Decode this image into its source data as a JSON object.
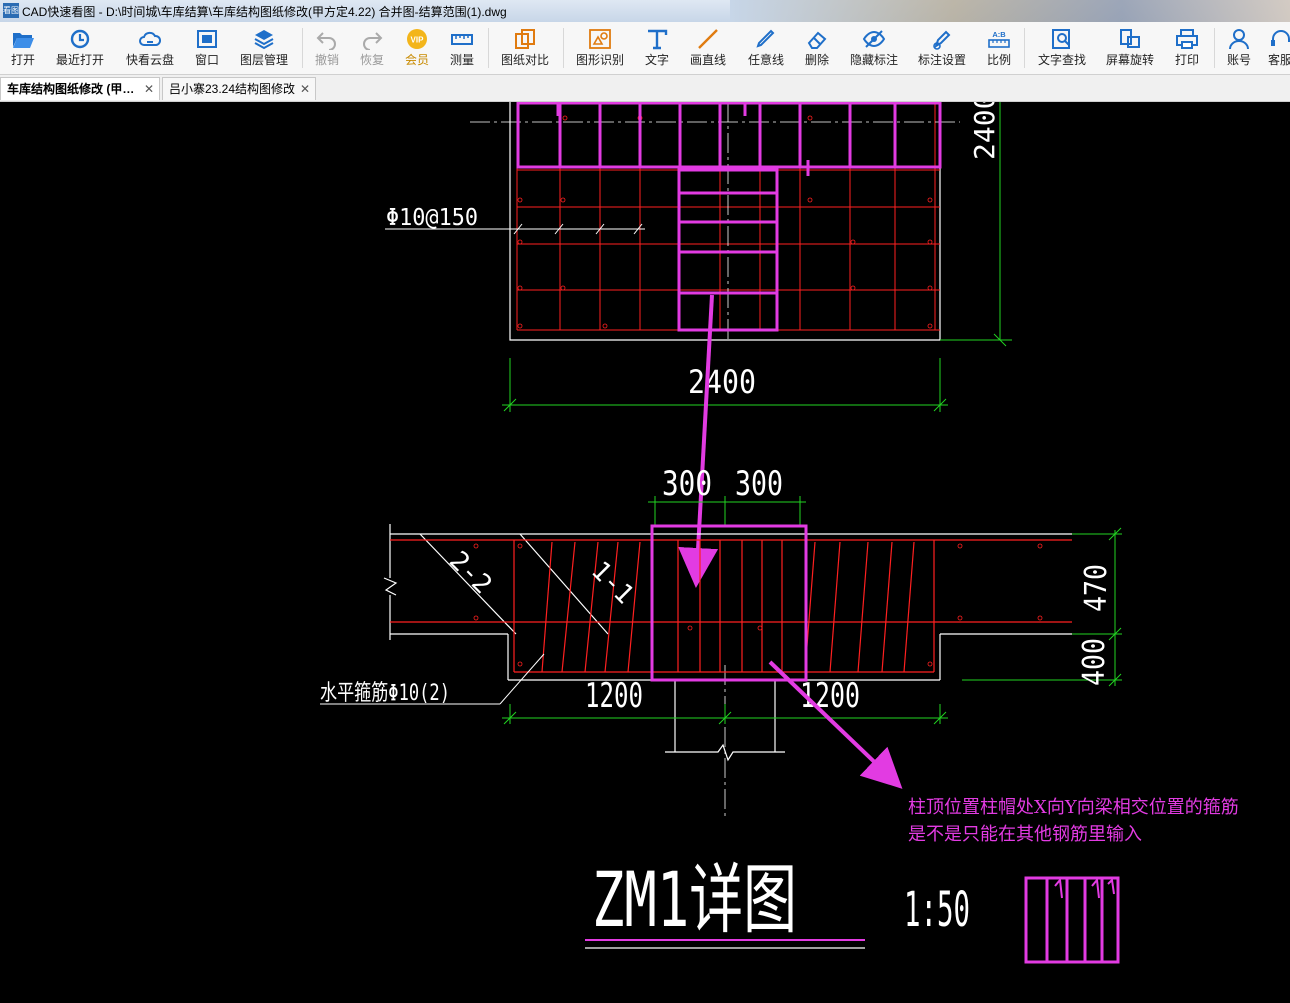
{
  "window": {
    "icon_text": "看图",
    "title": "CAD快速看图 - D:\\时间城\\车库结算\\车库结构图纸修改(甲方定4.22) 合并图-结算范围(1).dwg"
  },
  "toolbar": {
    "open": "打开",
    "recent": "最近打开",
    "cloud": "快看云盘",
    "window": "窗口",
    "layers": "图层管理",
    "undo": "撤销",
    "redo": "恢复",
    "vip": "会员",
    "measure": "测量",
    "compare": "图纸对比",
    "recognize": "图形识别",
    "text": "文字",
    "line": "画直线",
    "freeline": "任意线",
    "delete": "删除",
    "hide_annot": "隐藏标注",
    "annot_settings": "标注设置",
    "scale": "比例",
    "text_search": "文字查找",
    "rotate": "屏幕旋转",
    "print": "打印",
    "account": "账号",
    "support": "客服"
  },
  "tabs": [
    {
      "label": "车库结构图纸修改 (甲…",
      "active": true
    },
    {
      "label": "吕小寨23.24结构图修改",
      "active": false
    }
  ],
  "drawing": {
    "rebar_label": "Φ10@150",
    "dim_top_vertical": "2400",
    "dim_top_horizontal": "2400",
    "dim_300_left": "300",
    "dim_300_right": "300",
    "section_2_2": "2-2",
    "section_1_1": "1-1",
    "dim_470": "470",
    "dim_400": "400",
    "horizontal_stirrup_label": "水平箍筋Φ10(2)",
    "dim_1200_left": "1200",
    "dim_1200_right": "1200",
    "detail_title": "ZM1详图",
    "scale_text": "1:50"
  },
  "annotation": {
    "line1": "柱顶位置柱帽处X向Y向梁相交位置的箍筋",
    "line2": "是不是只能在其他钢筋里输入"
  },
  "colors": {
    "background": "#000000",
    "rebar": "#ff2020",
    "markup": "#e23be2",
    "dimension": "#22d322",
    "linework": "#ffffff"
  }
}
